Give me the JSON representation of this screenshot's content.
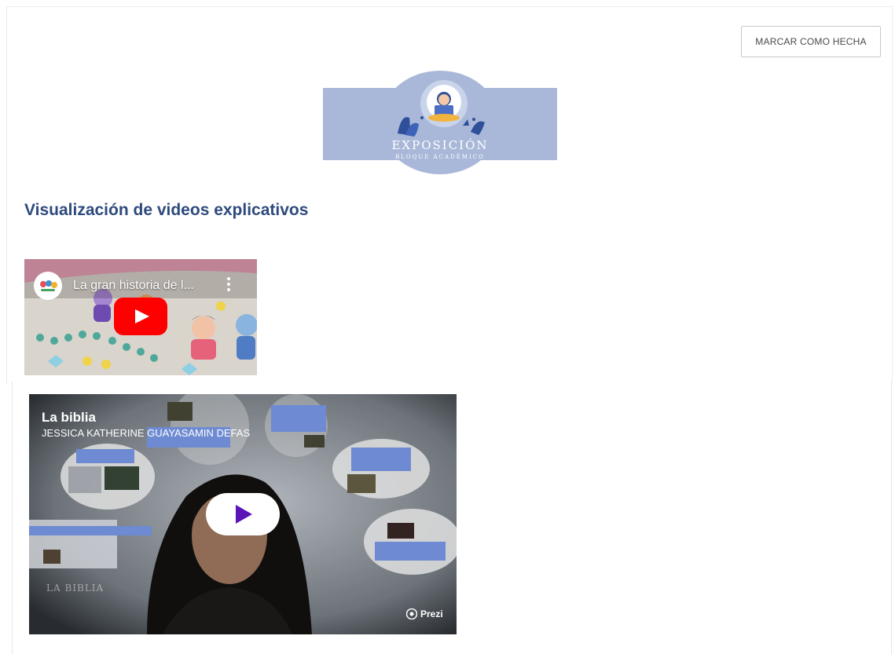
{
  "actions": {
    "mark_done_label": "MARCAR COMO HECHA"
  },
  "banner": {
    "title": "EXPOSICIÓN",
    "subtitle": "BLOQUE ACADÉMICO",
    "colors": {
      "background": "#a9b8d8",
      "accent": "#2f4f9a"
    }
  },
  "section": {
    "title": "Visualización de videos explicativos"
  },
  "videos": {
    "youtube": {
      "title": "La gran historia de l...",
      "channel_icon": "channel-avatar-icon",
      "menu_icon": "more-vert-icon",
      "play_icon": "play-icon",
      "play_color": "#ff0000"
    },
    "prezi": {
      "title": "La biblia",
      "author": "JESSICA KATHERINE GUAYASAMIN DEFAS",
      "watermark": "LA BIBLIA",
      "brand": "Prezi",
      "play_icon": "play-icon",
      "play_color": "#5b14b8"
    }
  }
}
